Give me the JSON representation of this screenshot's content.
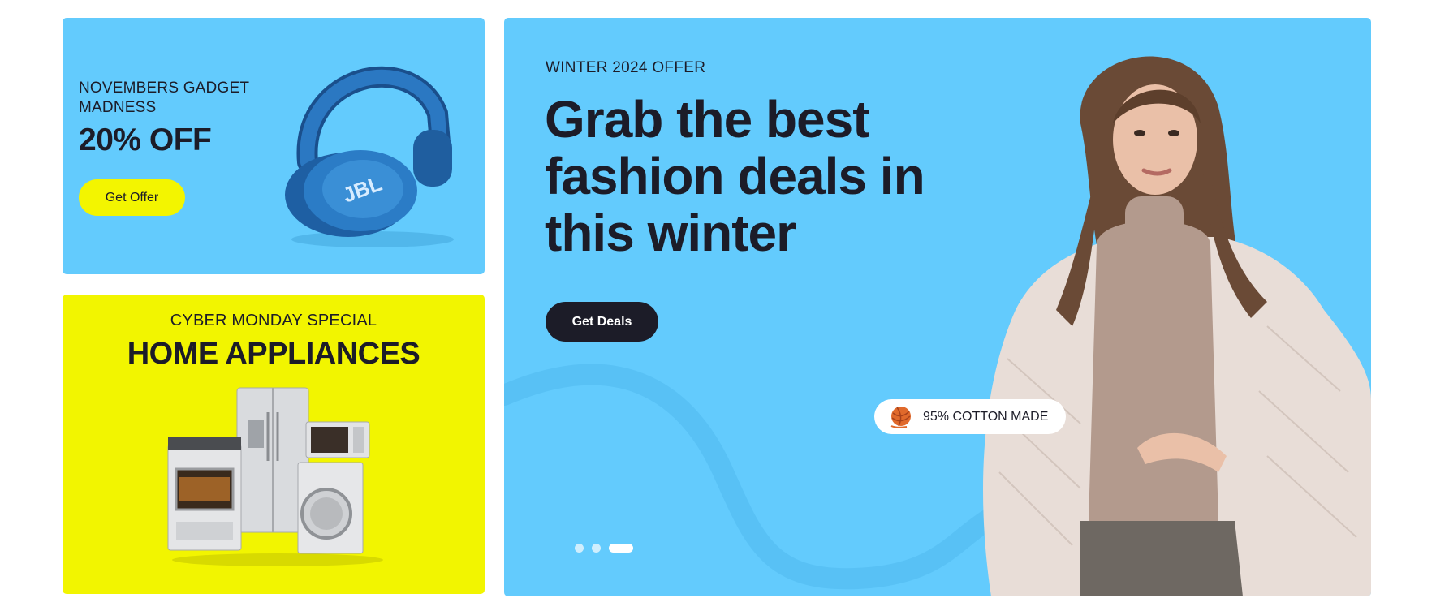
{
  "gadget_card": {
    "eyebrow": "NOVEMBERS GADGET MADNESS",
    "headline": "20% OFF",
    "button_label": "Get Offer",
    "image_label": "JBL"
  },
  "appliances_card": {
    "eyebrow": "CYBER MONDAY SPECIAL",
    "headline": "HOME APPLIANCES"
  },
  "hero": {
    "eyebrow": "WINTER 2024 OFFER",
    "headline": "Grab the best fashion deals in this winter",
    "button_label": "Get Deals",
    "badge_text": "95% COTTON MADE",
    "slides_count": 3,
    "active_slide": 3
  },
  "colors": {
    "sky": "#63cbfd",
    "yellow": "#f2f500",
    "dark": "#1c1c28",
    "white": "#ffffff"
  }
}
